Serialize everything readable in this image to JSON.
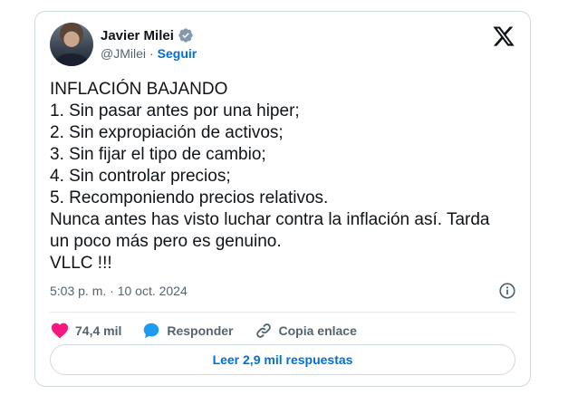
{
  "author": {
    "name": "Javier Milei",
    "handle": "@JMilei",
    "separator": "·",
    "follow_label": "Seguir"
  },
  "tweet": {
    "lines": [
      "INFLACIÓN BAJANDO",
      "1. Sin pasar antes por una hiper;",
      "2. Sin expropiación de activos;",
      "3. Sin fijar el tipo de cambio;",
      "4. Sin controlar precios;",
      "5. Recomponiendo precios relativos.",
      "Nunca antes has visto luchar contra la inflación así. Tarda",
      "un poco más pero es genuino.",
      "VLLC !!!"
    ],
    "timestamp": "5:03 p. m. · 10 oct. 2024"
  },
  "actions": {
    "likes_count": "74,4 mil",
    "reply_label": "Responder",
    "copy_link_label": "Copia enlace"
  },
  "read_replies_label": "Leer 2,9 mil respuestas",
  "colors": {
    "like": "#f91880",
    "reply": "#1d9bf0",
    "link": "#006fd6",
    "muted": "#536471",
    "border": "#cfd9de"
  },
  "icons": {
    "verified": "verified-badge-icon",
    "platform": "x-logo-icon",
    "info": "info-icon",
    "like": "heart-icon",
    "reply": "speech-bubble-icon",
    "copy": "chain-link-icon"
  }
}
